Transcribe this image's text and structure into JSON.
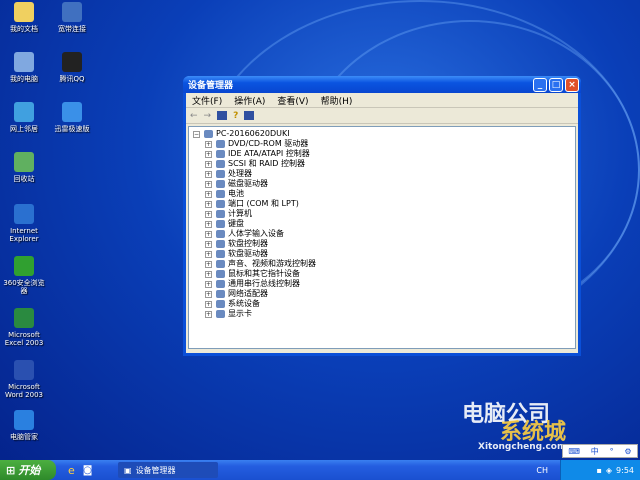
{
  "desktop": {
    "icons": [
      {
        "label": "我的文档",
        "color": "#f0d060"
      },
      {
        "label": "宽带连接",
        "color": "#4070c0"
      },
      {
        "label": "我的电脑",
        "color": "#80a8e0"
      },
      {
        "label": "腾讯QQ",
        "color": "#222"
      },
      {
        "label": "网上邻居",
        "color": "#40a0e0"
      },
      {
        "label": "迅雷极速版",
        "color": "#3a90e8"
      },
      {
        "label": "回收站",
        "color": "#60b060"
      },
      {
        "label": "Internet Explorer",
        "color": "#2a70d0"
      },
      {
        "label": "360安全浏览器",
        "color": "#30a030"
      },
      {
        "label": "Microsoft Excel 2003",
        "color": "#2a8a40"
      },
      {
        "label": "Microsoft Word 2003",
        "color": "#2a50b0"
      },
      {
        "label": "电脑管家",
        "color": "#2a80e0"
      }
    ]
  },
  "window": {
    "title": "设备管理器",
    "menu": [
      "文件(F)",
      "操作(A)",
      "查看(V)",
      "帮助(H)"
    ],
    "root": "PC-20160620DUKI",
    "devices": [
      "DVD/CD-ROM 驱动器",
      "IDE ATA/ATAPI 控制器",
      "SCSI 和 RAID 控制器",
      "处理器",
      "磁盘驱动器",
      "电池",
      "端口 (COM 和 LPT)",
      "计算机",
      "键盘",
      "人体学输入设备",
      "软盘控制器",
      "软盘驱动器",
      "声音、视频和游戏控制器",
      "鼠标和其它指针设备",
      "通用串行总线控制器",
      "网络适配器",
      "系统设备",
      "显示卡"
    ]
  },
  "watermark": {
    "line1": "电脑公司",
    "line2": "系统城",
    "line3": "Xitongcheng.com"
  },
  "taskbar": {
    "start": "开始",
    "task": "设备管理器",
    "lang": "CH",
    "time": "9:54",
    "langbar": "中"
  }
}
